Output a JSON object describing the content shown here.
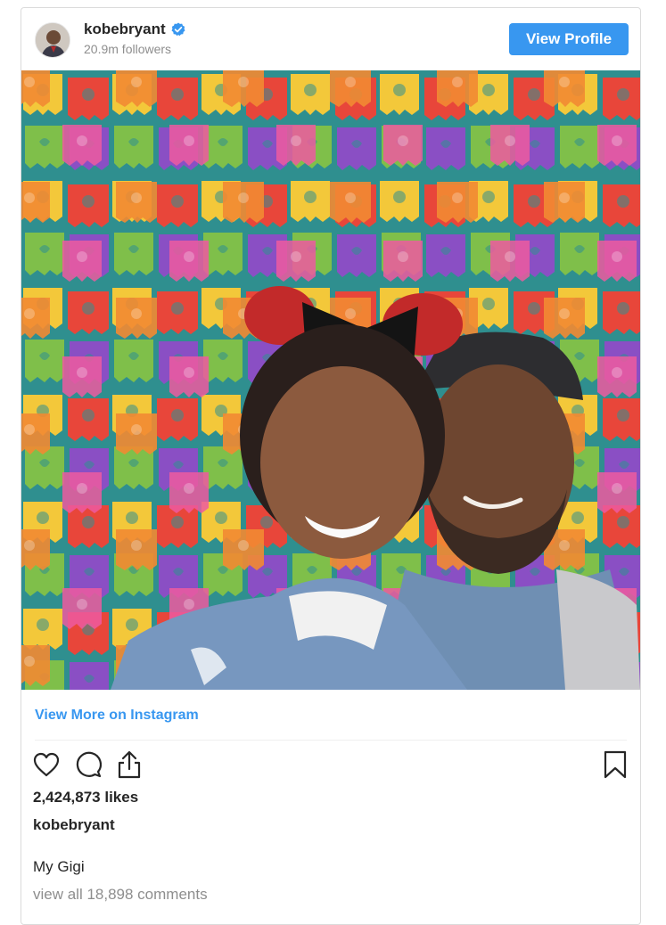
{
  "post": {
    "username": "kobebryant",
    "followers": "20.9m followers",
    "view_profile_label": "View Profile",
    "verified": true,
    "accent_color": "#3897f0",
    "view_more_label": "View More on Instagram",
    "likes": "2,424,873 likes",
    "caption_author": "kobebryant",
    "caption": "My Gigi",
    "comments_link": "view all 18,898 comments"
  },
  "icons": {
    "like": "heart-icon",
    "comment": "comment-icon",
    "share": "share-icon",
    "save": "bookmark-icon",
    "verified": "verified-badge-icon"
  }
}
